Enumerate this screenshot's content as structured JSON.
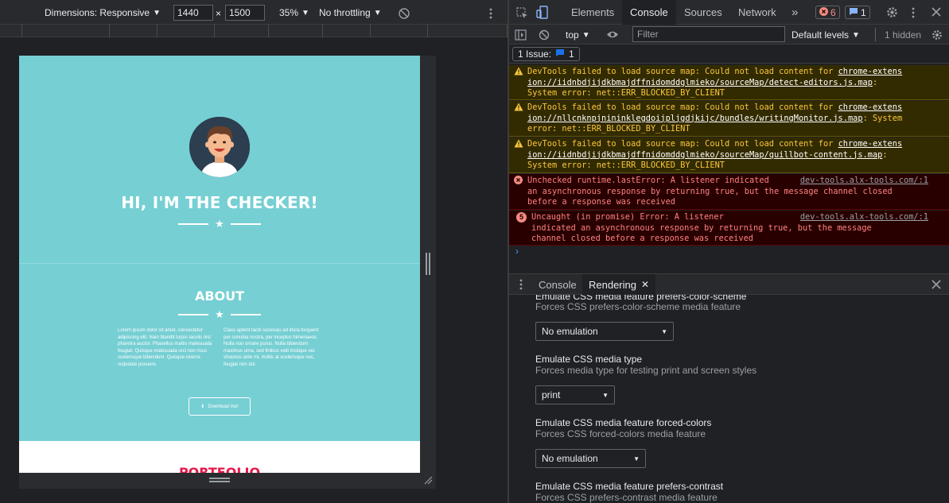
{
  "emulation": {
    "dimensions_label": "Dimensions: Responsive",
    "width": "1440",
    "height": "1500",
    "times": "×",
    "zoom": "35%",
    "throttling": "No throttling"
  },
  "site": {
    "hero_title": "HI, I'M THE CHECKER!",
    "about_title": "ABOUT",
    "about_col1": "Lorem ipsum dolor sit amet, consectetur adipiscing elit. Nam blandit turpis iaculis nisl pharetra auctor. Phasellus mattis malesuada feugiat. Quisque malesuada orci non risus scelerisque bibendum. Quisque viverra vulputate posuere.",
    "about_col2": "Class aptent taciti sociosqu ad litora torquent per conubia nostra, per inceptos himenaeos. Nulla non ornare purus. Nulla bibendum maximus urna, sed finibus velit tristique vel. Vivamus ante mi, mollis at scelerisque nec, feugiat non dui.",
    "download_label": "Download me!",
    "portfolio_title": "PORTFOLIO"
  },
  "devtools": {
    "tabs": [
      "Elements",
      "Console",
      "Sources",
      "Network"
    ],
    "more_tabs": "»",
    "error_count": "6",
    "message_count": "1",
    "console_toolbar": {
      "context": "top",
      "filter_placeholder": "Filter",
      "levels": "Default levels",
      "hidden": "1 hidden"
    },
    "issues": {
      "label": "1 Issue:",
      "count": "1"
    },
    "messages": [
      {
        "type": "warning",
        "pre": "DevTools failed to load source map: Could not load content for ",
        "link1": "chrome-extens",
        "link2": "ion://iidnbdjijdkbmajdffnidomddglmieko/sourceMap/detect-editors.js.map",
        "post1": ":",
        "post2": "System error: net::ERR_BLOCKED_BY_CLIENT"
      },
      {
        "type": "warning",
        "pre": "DevTools failed to load source map: Could not load content for ",
        "link1": "chrome-extens",
        "link2": "ion://nllcnknpjnininklegdoijpljgdjkijc/bundles/writingMonitor.js.map",
        "post1": ": System",
        "post2": "error: net::ERR_BLOCKED_BY_CLIENT"
      },
      {
        "type": "warning",
        "pre": "DevTools failed to load source map: Could not load content for ",
        "link1": "chrome-extens",
        "link2": "ion://iidnbdjijdkbmajdffnidomddglmieko/sourceMap/quillbot-content.js.map",
        "post1": ":",
        "post2": "System error: net::ERR_BLOCKED_BY_CLIENT"
      },
      {
        "type": "error",
        "line1": "Unchecked runtime.lastError: A listener indicated ",
        "source": "dev-tools.alx-tools.com/:1",
        "line2": "an asynchronous response by returning true, but the message channel closed",
        "line3": "before a response was received"
      },
      {
        "type": "error",
        "repeat": "5",
        "line1": "Uncaught (in promise) Error: A listener",
        "source": "dev-tools.alx-tools.com/:1",
        "line2": "indicated an asynchronous response by returning true, but the message",
        "line3": "channel closed before a response was received"
      }
    ],
    "prompt": "›",
    "drawer_tabs": [
      "Console",
      "Rendering"
    ],
    "rendering": [
      {
        "title": "Emulate CSS media feature prefers-color-scheme",
        "desc": "Forces CSS prefers-color-scheme media feature",
        "value": "No emulation"
      },
      {
        "title": "Emulate CSS media type",
        "desc": "Forces media type for testing print and screen styles",
        "value": "print"
      },
      {
        "title": "Emulate CSS media feature forced-colors",
        "desc": "Forces CSS forced-colors media feature",
        "value": "No emulation"
      },
      {
        "title": "Emulate CSS media feature prefers-contrast",
        "desc": "Forces CSS prefers-contrast media feature",
        "value": ""
      }
    ]
  },
  "colors": {
    "site_teal": "#76cfd3",
    "portfolio_red": "#e5184a",
    "warning_bg": "#332b00",
    "error_bg": "#290000",
    "accent_blue": "#4d90fe"
  }
}
